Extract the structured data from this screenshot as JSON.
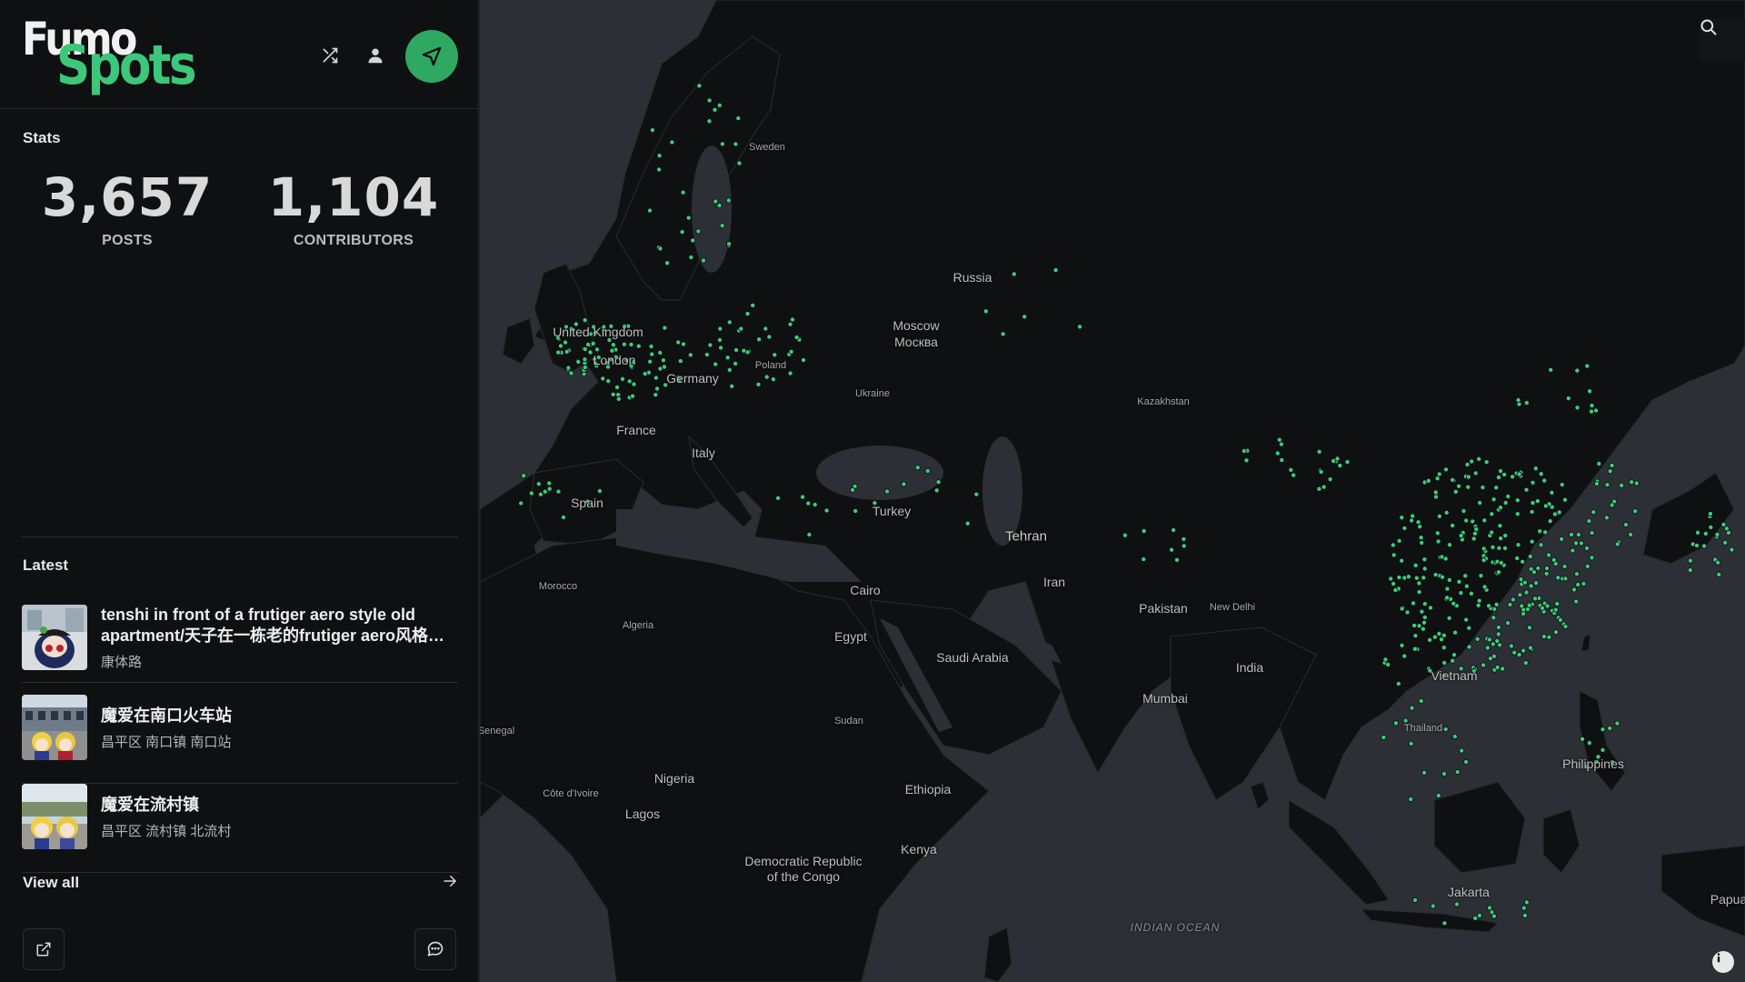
{
  "app": {
    "logo_line1": "Fumo",
    "logo_line2": "Spots",
    "accent_color": "#2fa862",
    "logo_green": "#3dc77a"
  },
  "header": {
    "icons": [
      "shuffle-icon",
      "user-icon",
      "navigate-icon"
    ]
  },
  "stats": {
    "title": "Stats",
    "posts_value": "3,657",
    "posts_label": "POSTS",
    "contributors_value": "1,104",
    "contributors_label": "CONTRIBUTORS"
  },
  "latest": {
    "title": "Latest",
    "posts": [
      {
        "title": "tenshi in front of a frutiger aero style old apartment/天子在一栋老的frutiger aero风格老式公寓前",
        "location": "康体路"
      },
      {
        "title": "魔爱在南口火车站",
        "location": "昌平区 南口镇 南口站"
      },
      {
        "title": "魔爱在流村镇",
        "location": "昌平区 流村镇 北流村"
      }
    ],
    "view_all": "View all"
  },
  "footer": {
    "icons": [
      "external-link-icon",
      "chat-icon"
    ]
  },
  "map": {
    "labels": {
      "sweden": "Sweden",
      "russia": "Russia",
      "moscow": "Moscow",
      "moscow_ru": "Москва",
      "uk": "United Kingdom",
      "london": "London",
      "poland": "Poland",
      "germany": "Germany",
      "ukraine": "Ukraine",
      "france": "France",
      "italy": "Italy",
      "spain": "Spain",
      "turkey": "Turkey",
      "kazakhstan": "Kazakhstan",
      "tehran": "Tehran",
      "iran": "Iran",
      "morocco": "Morocco",
      "algeria": "Algeria",
      "cairo": "Cairo",
      "egypt": "Egypt",
      "saudi": "Saudi Arabia",
      "pakistan": "Pakistan",
      "new_delhi": "New Delhi",
      "india": "India",
      "mumbai": "Mumbai",
      "senegal": "Senegal",
      "sudan": "Sudan",
      "nigeria": "Nigeria",
      "ethiopia": "Ethiopia",
      "cote": "Côte d'Ivoire",
      "lagos": "Lagos",
      "kenya": "Kenya",
      "drc1": "Democratic Republic",
      "drc2": "of the Congo",
      "vietnam": "Vietnam",
      "thailand": "Thailand",
      "philippines": "Philippines",
      "jakarta": "Jakarta",
      "papua": "Papua",
      "indian_ocean": "INDIAN OCEAN"
    },
    "land_color": "#0f1011",
    "water_color": "#2c2f35",
    "spot_color": "#3dcc7a"
  }
}
